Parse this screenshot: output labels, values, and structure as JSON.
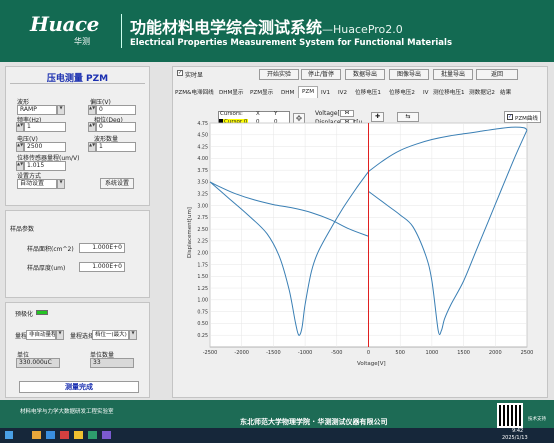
{
  "header": {
    "logo_brand": "Huace",
    "logo_sub": "华测",
    "title_cn": "功能材料电学综合测试系统",
    "title_version": "—HuacePro2.0",
    "title_en": "Electrical Properties Measurement System for Functional Materials"
  },
  "left": {
    "panel_title": "压电测量 PZM",
    "waveform_label": "波形",
    "waveform_value": "RAMP",
    "bias_label": "偏压(V)",
    "bias_value": "0",
    "freq_label": "频率(Hz)",
    "freq_value": "1",
    "phase_label": "相位(Deg)",
    "phase_value": "0",
    "voltage_label": "电压(V)",
    "voltage_value": "2500",
    "count_label": "波形数量",
    "count_value": "1",
    "sensitivity_label": "位移传感器量程(um/V)",
    "sensitivity_value": "1.015",
    "mode_label": "设置方式",
    "mode_value": "自动设置",
    "settings_button": "系统设置",
    "sample_title": "样品参数",
    "area_label": "样品面积(cm^2)",
    "area_value": "1.000E+0",
    "thick_label": "样品厚度(um)",
    "thick_value": "1.000E+0",
    "status_label": "预极化",
    "range_label": "量程",
    "range_value": "非自动量程",
    "range_select_label": "量程选择",
    "range_select_value": "档位一(最大)",
    "unit_label": "单位",
    "unit_value": "330.000uC",
    "unit_count_label": "单位数量",
    "unit_count_value": "33",
    "complete_label": "测量完成"
  },
  "toolbar": {
    "realtime_label": "实时显",
    "buttons": [
      "开始实验",
      "停止/暂停",
      "数据导出",
      "图像导出",
      "批量导出",
      "返回"
    ]
  },
  "tabs": [
    "PZM&电滞回线",
    "DHM显示",
    "PZM显示",
    "DHM",
    "PZM",
    "IV1",
    "IV2",
    "位移电压1",
    "位移电压2",
    "IV",
    "测位移电压1",
    "测数据记2",
    "结果"
  ],
  "active_tab": 4,
  "cursor_table": {
    "headers": [
      "Cursors:",
      "X",
      "Y"
    ],
    "row": [
      "Cursor 0",
      "0",
      "0"
    ]
  },
  "legend": {
    "voltage": "Voltage[V]",
    "displacement": "Displacement[u",
    "pzm_line": "PZM曲线"
  },
  "colors": {
    "accent_green": "#136a52",
    "series_blue": "#3a7fb4",
    "axis_red": "#e02020"
  },
  "footer": {
    "left_text": "材料电学与力学大数据研发工程实验室",
    "center_text": "东北师范大学物理学院 · 华测测试仪器有限公司",
    "support": "技术支持",
    "time": "9:42",
    "date": "2025/1/13"
  },
  "chart_data": {
    "type": "line",
    "title": "",
    "xlabel": "Voltage[V]",
    "ylabel": "Displacement[um]",
    "xlim": [
      -2500,
      2500
    ],
    "ylim": [
      0,
      4.75
    ],
    "xticks": [
      -2500,
      -2000,
      -1500,
      -1000,
      -500,
      0,
      500,
      1000,
      1500,
      2000,
      2500
    ],
    "yticks": [
      0.25,
      0.5,
      0.75,
      1,
      1.25,
      1.5,
      1.75,
      2,
      2.25,
      2.5,
      2.75,
      3,
      3.25,
      3.5,
      3.75,
      4,
      4.25,
      4.5,
      4.75
    ],
    "series": [
      {
        "x": [
          -2500,
          -2200,
          -1900,
          -1600,
          -1400,
          -1250,
          -1150,
          -1100,
          -1050,
          -1000,
          -900,
          -800,
          -600,
          -400,
          -200,
          0
        ],
        "y": [
          3.5,
          3.15,
          2.8,
          2.4,
          1.9,
          1.2,
          0.5,
          0.25,
          0.4,
          0.9,
          1.6,
          2.0,
          2.5,
          2.95,
          3.35,
          3.72
        ]
      },
      {
        "x": [
          0,
          250,
          500,
          750,
          1000,
          1250,
          1500,
          1750,
          2000,
          2250,
          2450,
          2500
        ],
        "y": [
          3.72,
          3.97,
          4.17,
          4.3,
          4.4,
          4.47,
          4.52,
          4.57,
          4.62,
          4.66,
          4.65,
          4.6
        ]
      },
      {
        "x": [
          2500,
          2300,
          2100,
          1900,
          1700,
          1500,
          1300,
          1200,
          1150,
          1100,
          1000,
          900,
          700,
          500,
          300,
          0
        ],
        "y": [
          4.6,
          4.0,
          3.35,
          2.7,
          2.05,
          1.4,
          0.9,
          0.6,
          0.35,
          0.35,
          1.4,
          1.95,
          2.55,
          2.8,
          3.0,
          3.3
        ]
      },
      {
        "x": [
          0,
          -300,
          -600,
          -900,
          -1200,
          -1500,
          -1800,
          -2100,
          -2350,
          -2500
        ],
        "y": [
          2.35,
          2.5,
          2.7,
          2.85,
          2.95,
          3.02,
          3.12,
          3.25,
          3.4,
          3.5
        ]
      }
    ]
  }
}
